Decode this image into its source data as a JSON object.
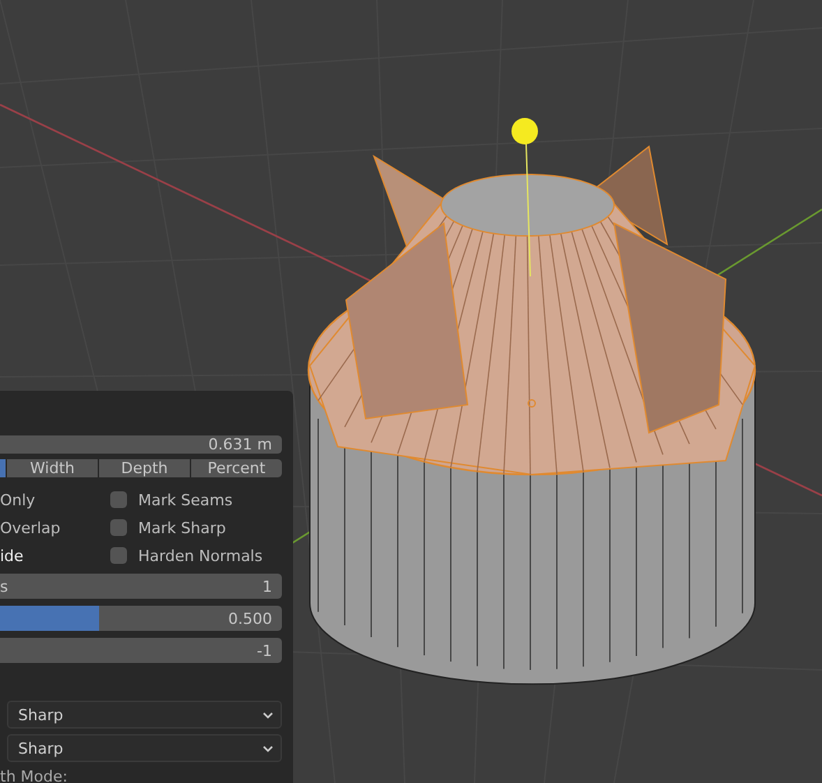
{
  "panel": {
    "amount": {
      "value": "0.631 m"
    },
    "width_type": [
      {
        "selected": true
      },
      {
        "label": "Width",
        "selected": false
      },
      {
        "label": "Depth",
        "selected": false
      },
      {
        "label": "Percent",
        "selected": false
      }
    ],
    "options_left": [
      {
        "label": "Only",
        "checked": false
      },
      {
        "label": "Overlap",
        "checked": false
      },
      {
        "label": "ide",
        "checked": true
      }
    ],
    "options_right": [
      {
        "label": "Mark Seams",
        "checked": false
      },
      {
        "label": "Mark Sharp",
        "checked": false
      },
      {
        "label": "Harden Normals",
        "checked": false
      }
    ],
    "fields": [
      {
        "kind": "number",
        "label": "s",
        "value": "1"
      },
      {
        "kind": "slider",
        "value": "0.500",
        "level": 0.35
      },
      {
        "kind": "number",
        "value": "-1"
      }
    ],
    "dropdowns": [
      {
        "value": "Sharp"
      },
      {
        "value": "Sharp"
      }
    ],
    "footer_label": "th Mode:"
  }
}
